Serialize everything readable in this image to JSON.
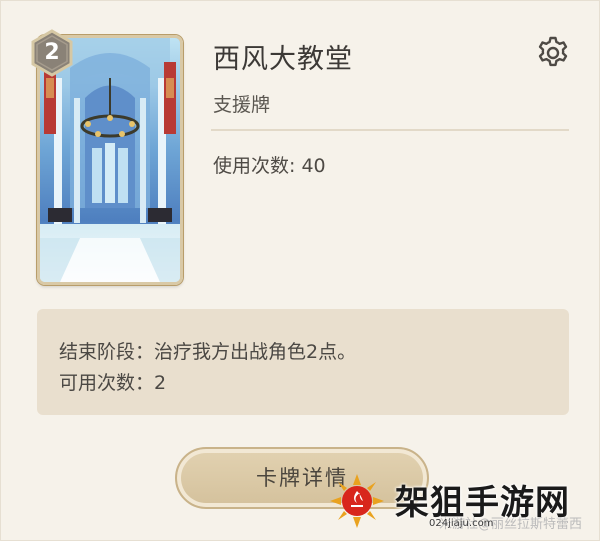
{
  "card": {
    "cost": "2",
    "title": "西风大教堂",
    "type": "支援牌",
    "uses_label": "使用次数: 40"
  },
  "effect": {
    "line1": "结束阶段：治疗我方出战角色2点。",
    "line2": "可用次数：2"
  },
  "buttons": {
    "details_label": "卡牌详情"
  },
  "icons": {
    "settings": "gear-icon",
    "cost": "dice-hexagon-icon"
  },
  "watermark": {
    "title": "架狙手游网",
    "url": "024jiaju.com",
    "credit": "米游社@丽丝拉斯特蕾西"
  },
  "colors": {
    "background": "#f6f2ea",
    "effect_box": "#e9dfce",
    "button": "#d9c7a4",
    "text": "#4b4844"
  }
}
